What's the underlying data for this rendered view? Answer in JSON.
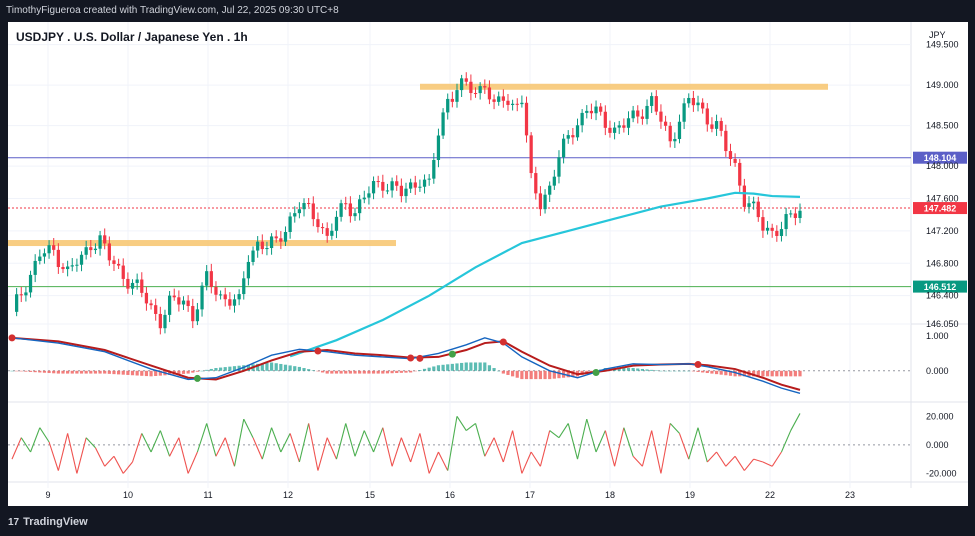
{
  "header": {
    "attribution": "TimothyFigueroa created with TradingView.com, Jul 22, 2025 09:30 UTC+8"
  },
  "footer": {
    "brand": "TradingView"
  },
  "chart_data": [
    {
      "type": "candlestick",
      "title": "USDJPY . U.S. Dollar / Japanese Yen . 1h",
      "currency_label": "JPY",
      "x_ticks": [
        "9",
        "10",
        "11",
        "12",
        "15",
        "16",
        "17",
        "18",
        "19",
        "22",
        "23"
      ],
      "y_ticks": [
        "146.050",
        "146.400",
        "146.800",
        "147.200",
        "147.600",
        "148.000",
        "148.500",
        "149.000",
        "149.500"
      ],
      "ylim": [
        146.05,
        149.78
      ],
      "price_labels": [
        {
          "value": "148.104",
          "color": "#5b5fc7"
        },
        {
          "value": "147.482",
          "color": "#f23645"
        },
        {
          "value": "146.512",
          "color": "#089981"
        }
      ],
      "horizontal_lines": [
        {
          "value": 148.104,
          "color": "#5b5fc7",
          "style": "solid"
        },
        {
          "value": 147.482,
          "color": "#f23645",
          "style": "dotted"
        },
        {
          "value": 146.512,
          "color": "#4caf50",
          "style": "solid"
        }
      ],
      "zones": [
        {
          "from_day": "8.5",
          "to_day": "15.3",
          "price": 147.05,
          "color": "#f7c46c"
        },
        {
          "from_day": "15.7",
          "to_day": "20.0",
          "price": 148.98,
          "color": "#f7c46c"
        }
      ],
      "price_path": [
        [
          0,
          146.2
        ],
        [
          3,
          146.55
        ],
        [
          6,
          146.9
        ],
        [
          9,
          146.95
        ],
        [
          12,
          146.7
        ],
        [
          15,
          146.85
        ],
        [
          17,
          147.05
        ],
        [
          19,
          147.1
        ],
        [
          21,
          146.85
        ],
        [
          24,
          146.65
        ],
        [
          27,
          146.5
        ],
        [
          30,
          146.25
        ],
        [
          32,
          146.1
        ],
        [
          34,
          146.3
        ],
        [
          37,
          146.35
        ],
        [
          39,
          146.15
        ],
        [
          42,
          146.6
        ],
        [
          45,
          146.4
        ],
        [
          47,
          146.35
        ],
        [
          49,
          146.3
        ],
        [
          51,
          146.9
        ],
        [
          53,
          147.05
        ],
        [
          55,
          147.0
        ],
        [
          57,
          147.05
        ],
        [
          60,
          147.35
        ],
        [
          62,
          147.5
        ],
        [
          64,
          147.45
        ],
        [
          66,
          147.35
        ],
        [
          68,
          147.1
        ],
        [
          70,
          147.35
        ],
        [
          72,
          147.55
        ],
        [
          74,
          147.45
        ],
        [
          76,
          147.6
        ],
        [
          78,
          147.75
        ],
        [
          80,
          147.8
        ],
        [
          82,
          147.75
        ],
        [
          84,
          147.65
        ],
        [
          86,
          147.75
        ],
        [
          88,
          147.85
        ],
        [
          90,
          147.75
        ],
        [
          92,
          148.4
        ],
        [
          94,
          148.85
        ],
        [
          96,
          148.95
        ],
        [
          98,
          149.0
        ],
        [
          100,
          148.9
        ],
        [
          102,
          149.05
        ],
        [
          104,
          148.7
        ],
        [
          106,
          148.85
        ],
        [
          108,
          148.75
        ],
        [
          110,
          148.85
        ],
        [
          112,
          147.8
        ],
        [
          114,
          147.55
        ],
        [
          116,
          147.75
        ],
        [
          118,
          148.1
        ],
        [
          120,
          148.35
        ],
        [
          122,
          148.55
        ],
        [
          124,
          148.7
        ],
        [
          126,
          148.65
        ],
        [
          128,
          148.55
        ],
        [
          130,
          148.45
        ],
        [
          132,
          148.5
        ],
        [
          134,
          148.6
        ],
        [
          136,
          148.7
        ],
        [
          138,
          148.8
        ],
        [
          140,
          148.55
        ],
        [
          142,
          148.3
        ],
        [
          144,
          148.6
        ],
        [
          146,
          148.8
        ],
        [
          148,
          148.75
        ],
        [
          150,
          148.6
        ],
        [
          152,
          148.5
        ],
        [
          154,
          148.2
        ],
        [
          156,
          148.0
        ],
        [
          158,
          147.6
        ],
        [
          160,
          147.45
        ],
        [
          162,
          147.25
        ],
        [
          164,
          147.2
        ],
        [
          166,
          147.25
        ],
        [
          168,
          147.35
        ],
        [
          170,
          147.48
        ]
      ],
      "ema_path": [
        [
          60,
          145.65
        ],
        [
          70,
          145.85
        ],
        [
          80,
          146.1
        ],
        [
          90,
          146.4
        ],
        [
          100,
          146.75
        ],
        [
          110,
          147.05
        ],
        [
          120,
          147.2
        ],
        [
          130,
          147.35
        ],
        [
          140,
          147.5
        ],
        [
          150,
          147.6
        ],
        [
          156,
          147.67
        ],
        [
          160,
          147.66
        ],
        [
          164,
          147.63
        ],
        [
          170,
          147.62
        ]
      ],
      "ema_color": "#26c6da"
    },
    {
      "type": "macd",
      "y_ticks": [
        "1.000",
        "0.000"
      ],
      "ylim": [
        -0.9,
        1.35
      ],
      "macd_path": [
        [
          0,
          0.95
        ],
        [
          10,
          0.8
        ],
        [
          20,
          0.55
        ],
        [
          30,
          0.05
        ],
        [
          38,
          -0.25
        ],
        [
          44,
          -0.2
        ],
        [
          50,
          0.1
        ],
        [
          56,
          0.45
        ],
        [
          62,
          0.62
        ],
        [
          68,
          0.55
        ],
        [
          74,
          0.45
        ],
        [
          80,
          0.4
        ],
        [
          86,
          0.35
        ],
        [
          92,
          0.5
        ],
        [
          98,
          0.75
        ],
        [
          102,
          0.95
        ],
        [
          106,
          0.8
        ],
        [
          110,
          0.4
        ],
        [
          116,
          0.0
        ],
        [
          122,
          -0.2
        ],
        [
          128,
          0.05
        ],
        [
          134,
          0.2
        ],
        [
          140,
          0.18
        ],
        [
          146,
          0.2
        ],
        [
          150,
          0.12
        ],
        [
          156,
          -0.05
        ],
        [
          162,
          -0.3
        ],
        [
          166,
          -0.5
        ],
        [
          170,
          -0.65
        ]
      ],
      "signal_path": [
        [
          0,
          0.95
        ],
        [
          10,
          0.85
        ],
        [
          20,
          0.6
        ],
        [
          30,
          0.15
        ],
        [
          38,
          -0.2
        ],
        [
          44,
          -0.25
        ],
        [
          50,
          0.0
        ],
        [
          56,
          0.3
        ],
        [
          62,
          0.55
        ],
        [
          68,
          0.6
        ],
        [
          74,
          0.5
        ],
        [
          80,
          0.45
        ],
        [
          86,
          0.38
        ],
        [
          92,
          0.4
        ],
        [
          98,
          0.6
        ],
        [
          102,
          0.8
        ],
        [
          106,
          0.85
        ],
        [
          110,
          0.55
        ],
        [
          116,
          0.15
        ],
        [
          122,
          -0.1
        ],
        [
          128,
          0.0
        ],
        [
          134,
          0.15
        ],
        [
          140,
          0.18
        ],
        [
          146,
          0.2
        ],
        [
          150,
          0.16
        ],
        [
          156,
          0.05
        ],
        [
          162,
          -0.2
        ],
        [
          166,
          -0.4
        ],
        [
          170,
          -0.55
        ]
      ],
      "cross_markers": [
        {
          "i": 0,
          "v": 0.95,
          "color": "#d32f2f"
        },
        {
          "i": 40,
          "v": -0.22,
          "color": "#43a047"
        },
        {
          "i": 66,
          "v": 0.57,
          "color": "#d32f2f"
        },
        {
          "i": 86,
          "v": 0.37,
          "color": "#d32f2f"
        },
        {
          "i": 88,
          "v": 0.36,
          "color": "#d32f2f"
        },
        {
          "i": 95,
          "v": 0.48,
          "color": "#43a047"
        },
        {
          "i": 106,
          "v": 0.83,
          "color": "#d32f2f"
        },
        {
          "i": 126,
          "v": -0.05,
          "color": "#43a047"
        },
        {
          "i": 148,
          "v": 0.18,
          "color": "#d32f2f"
        }
      ],
      "macd_color": "#1565c0",
      "signal_color": "#b71c1c"
    },
    {
      "type": "rsi_osc",
      "y_ticks": [
        "20.000",
        "0.000",
        "-20.000"
      ],
      "ylim": [
        -26,
        30
      ],
      "path": [
        [
          0,
          -10
        ],
        [
          2,
          5
        ],
        [
          4,
          -5
        ],
        [
          6,
          12
        ],
        [
          8,
          2
        ],
        [
          10,
          -18
        ],
        [
          12,
          8
        ],
        [
          14,
          -20
        ],
        [
          16,
          5
        ],
        [
          18,
          -2
        ],
        [
          20,
          -15
        ],
        [
          22,
          -8
        ],
        [
          24,
          -20
        ],
        [
          26,
          -12
        ],
        [
          28,
          8
        ],
        [
          30,
          -5
        ],
        [
          32,
          10
        ],
        [
          34,
          -8
        ],
        [
          36,
          5
        ],
        [
          38,
          -20
        ],
        [
          40,
          -5
        ],
        [
          42,
          15
        ],
        [
          44,
          -8
        ],
        [
          46,
          5
        ],
        [
          48,
          -15
        ],
        [
          50,
          18
        ],
        [
          52,
          5
        ],
        [
          54,
          -10
        ],
        [
          56,
          12
        ],
        [
          58,
          -5
        ],
        [
          60,
          8
        ],
        [
          62,
          -12
        ],
        [
          64,
          15
        ],
        [
          66,
          -18
        ],
        [
          68,
          5
        ],
        [
          70,
          -10
        ],
        [
          72,
          15
        ],
        [
          74,
          -8
        ],
        [
          76,
          10
        ],
        [
          78,
          -5
        ],
        [
          80,
          12
        ],
        [
          82,
          -15
        ],
        [
          84,
          5
        ],
        [
          86,
          -12
        ],
        [
          88,
          8
        ],
        [
          90,
          -20
        ],
        [
          92,
          -5
        ],
        [
          94,
          -18
        ],
        [
          96,
          20
        ],
        [
          98,
          10
        ],
        [
          100,
          15
        ],
        [
          102,
          -8
        ],
        [
          104,
          5
        ],
        [
          106,
          -12
        ],
        [
          108,
          10
        ],
        [
          110,
          -20
        ],
        [
          112,
          -5
        ],
        [
          114,
          -15
        ],
        [
          116,
          10
        ],
        [
          118,
          5
        ],
        [
          120,
          15
        ],
        [
          122,
          -10
        ],
        [
          124,
          18
        ],
        [
          126,
          -5
        ],
        [
          128,
          10
        ],
        [
          130,
          -15
        ],
        [
          132,
          12
        ],
        [
          134,
          -8
        ],
        [
          136,
          -15
        ],
        [
          138,
          10
        ],
        [
          140,
          -20
        ],
        [
          142,
          15
        ],
        [
          144,
          8
        ],
        [
          146,
          -10
        ],
        [
          148,
          12
        ],
        [
          150,
          -12
        ],
        [
          152,
          -5
        ],
        [
          154,
          -15
        ],
        [
          156,
          -8
        ],
        [
          158,
          -18
        ],
        [
          160,
          -10
        ],
        [
          162,
          -12
        ],
        [
          164,
          -15
        ],
        [
          166,
          -5
        ],
        [
          168,
          10
        ],
        [
          170,
          22
        ]
      ],
      "pos_color": "#4caf50",
      "neg_color": "#ef5350"
    }
  ]
}
